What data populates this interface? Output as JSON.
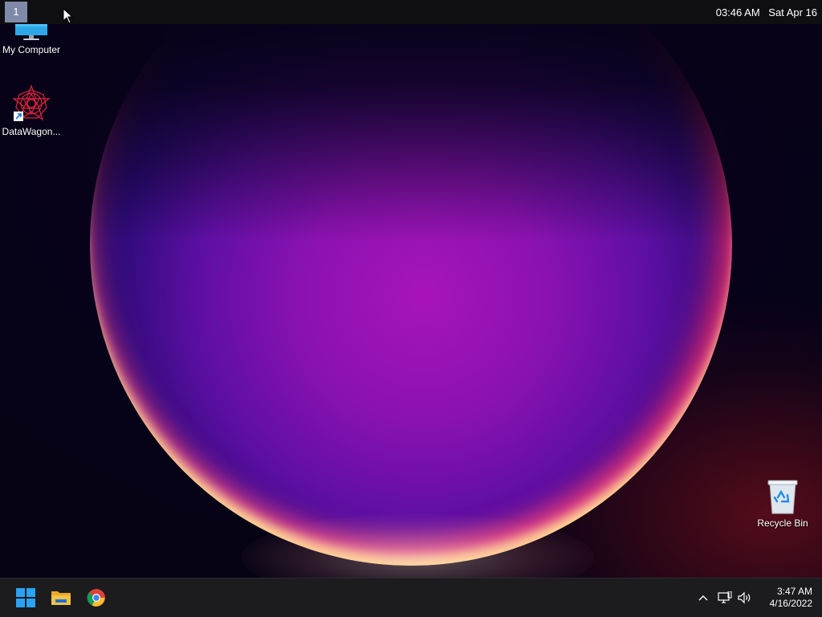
{
  "top_bar": {
    "workspace": "1",
    "time": "03:46 AM",
    "date": "Sat Apr 16"
  },
  "desktop": {
    "icons": [
      {
        "label": "My Computer",
        "icon": "monitor-icon"
      },
      {
        "label": "DataWagon...",
        "icon": "datawagon-app-icon"
      },
      {
        "label": "Recycle Bin",
        "icon": "recycle-bin-icon"
      }
    ]
  },
  "taskbar": {
    "pinned": [
      {
        "name": "Start",
        "icon": "windows-logo-icon"
      },
      {
        "name": "File Explorer",
        "icon": "folder-icon"
      },
      {
        "name": "Google Chrome",
        "icon": "chrome-icon"
      }
    ],
    "tray": {
      "icons": [
        "chevron-up-icon",
        "network-icon",
        "volume-icon"
      ],
      "time": "3:47 AM",
      "date": "4/16/2022"
    }
  },
  "colors": {
    "taskbar_bg": "#1c1c1f",
    "top_bar_bg": "#0f0f12",
    "workspace_badge": "#7f8aa8",
    "windows_blue": "#29a3f5",
    "folder_yellow": "#f5c342"
  }
}
